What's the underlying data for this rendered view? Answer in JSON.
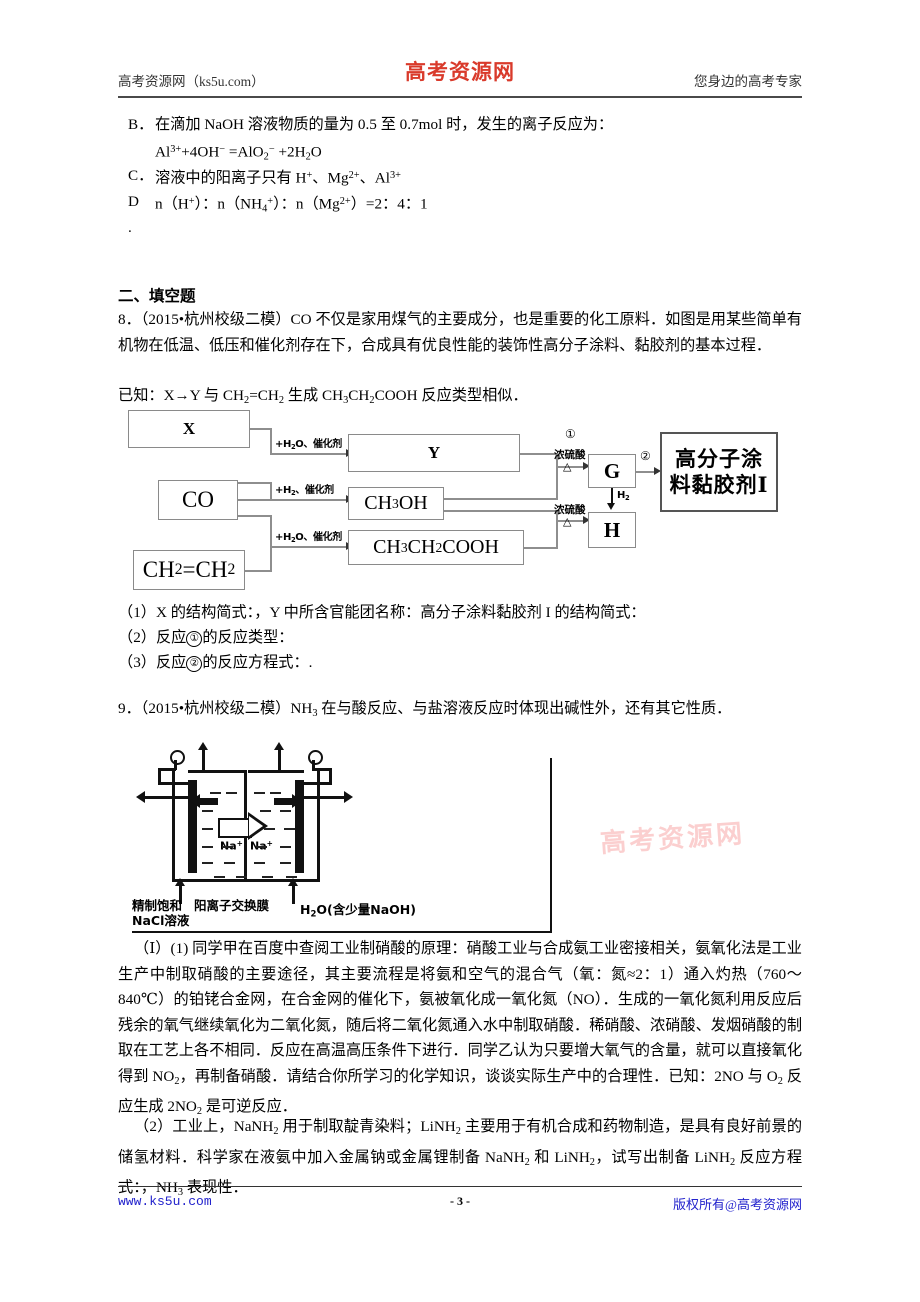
{
  "header": {
    "left": "高考资源网（ks5u.com）",
    "center": "高考资源网",
    "right": "您身边的高考专家"
  },
  "options": [
    {
      "label": "B．",
      "line1_a": "在滴加 NaOH 溶液物质的量为 0.5 至 0.7mol 时，发生的离子反应为：",
      "line2": "Al3++4OH− =AlO2− +2H2O"
    },
    {
      "label": "C．",
      "line1_a": "溶液中的阳离子只有 H+、Mg2+、Al3+"
    },
    {
      "label": "D",
      "line1_a": "n（H+）：n（NH4+）：n（Mg2+）=2：4：1"
    },
    {
      "label": ".",
      "line1_a": ""
    }
  ],
  "section": {
    "title": "二、填空题"
  },
  "q8": {
    "p1": "8．（2015•杭州校级二模）CO 不仅是家用煤气的主要成分，也是重要的化工原料．如图是用某些简单有机物在低温、低压和催化剂存在下，合成具有优良性能的装饰性高分子涂料、黏胶剂的基本过程．",
    "p2": "已知：X→Y 与 CH2=CH2 生成 CH3CH2COOH 反应类型相似．",
    "sub1": "（1）X 的结构简式：，Y 中所含官能团名称：高分子涂料黏胶剂 I 的结构简式：",
    "sub2_pre": "（2）反应",
    "sub2_num": "①",
    "sub2_post": "的反应类型：",
    "sub3_pre": "（3）反应",
    "sub3_num": "②",
    "sub3_post": "的反应方程式：."
  },
  "flow": {
    "box_x": "X",
    "box_co": "CO",
    "box_ethene": "CH2=CH2",
    "box_y": "Y",
    "box_methanol": "CH3OH",
    "box_propanoic": "CH3CH2COOH",
    "box_g": "G",
    "box_h": "H",
    "product_line1": "高分子涂",
    "product_line2": "料黏胶剂I",
    "arrow_label_1": "+H2O、催化剂",
    "arrow_label_2": "+H2、催化剂",
    "arrow_label_3": "+H2O、催化剂",
    "cond_acid_1": "浓硫酸",
    "cond_delta_1": "△",
    "cond_acid_2": "浓硫酸",
    "cond_delta_2": "△",
    "num_1": "①",
    "num_2": "②",
    "h2_label": "H2"
  },
  "q9": {
    "intro": "9．（2015•杭州校级二模）NH3 在与酸反应、与盐溶液反应时体现出碱性外，还有其它性质．",
    "cell": {
      "label_left": "精制饱和",
      "label_left2": "NaCl溶液",
      "label_membrane": "阳离子交换膜",
      "label_right": "H2O(含少量NaOH)",
      "ion_left": "Na+",
      "ion_right": "Na+"
    },
    "watermark": "高考资源网",
    "pI": "（Ⅰ）(1) 同学甲在百度中查阅工业制硝酸的原理：硝酸工业与合成氨工业密接相关，氨氧化法是工业生产中制取硝酸的主要途径，其主要流程是将氨和空气的混合气（氧：氮≈2：1）通入灼热（760～840℃）的铂铑合金网，在合金网的催化下，氨被氧化成一氧化氮（NO）．生成的一氧化氮利用反应后残余的氧气继续氧化为二氧化氮，随后将二氧化氮通入水中制取硝酸．稀硝酸、浓硝酸、发烟硝酸的制取在工艺上各不相同．反应在高温高压条件下进行．同学乙认为只要增大氧气的含量，就可以直接氧化得到 NO2，再制备硝酸．请结合你所学习的化学知识，谈谈实际生产中的合理性．已知：2NO 与 O2 反应生成 2NO2 是可逆反应．",
    "p2": "（2）工业上，NaNH2 用于制取靛青染料；LiNH2 主要用于有机合成和药物制造，是具有良好前景的储氢材料．科学家在液氨中加入金属钠或金属锂制备 NaNH2 和 LiNH2，试写出制备 LiNH2 反应方程式：，NH3 表现性."
  },
  "footer": {
    "left": "www.ks5u.com",
    "center": "- 3 -",
    "right": "版权所有@高考资源网"
  }
}
